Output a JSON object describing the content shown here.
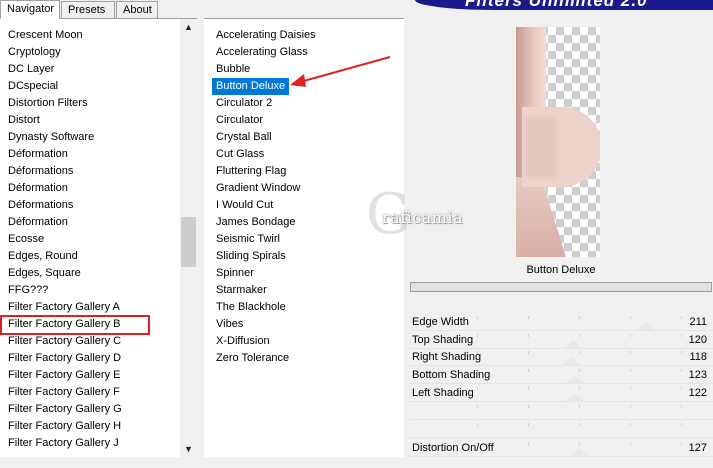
{
  "tabs": [
    "Navigator",
    "Presets",
    "About"
  ],
  "banner_title": "Filters Unlimited 2.0",
  "categories": [
    "Crescent Moon",
    "Cryptology",
    "DC Layer",
    "DCspecial",
    "Distortion Filters",
    "Distort",
    "Dynasty Software",
    "Déformation",
    "Déformations",
    "Déformation",
    "Déformations",
    "Déformation",
    "Ecosse",
    "Edges, Round",
    "Edges, Square",
    "FFG???",
    "Filter Factory Gallery A",
    "Filter Factory Gallery B",
    "Filter Factory Gallery C",
    "Filter Factory Gallery D",
    "Filter Factory Gallery E",
    "Filter Factory Gallery F",
    "Filter Factory Gallery G",
    "Filter Factory Gallery H",
    "Filter Factory Gallery J"
  ],
  "highlighted_category": "Filter Factory Gallery B",
  "filters": [
    "Accelerating Daisies",
    "Accelerating Glass",
    "Bubble",
    "Button Deluxe",
    "Circulator 2",
    "Circulator",
    "Crystal Ball",
    "Cut Glass",
    "Fluttering Flag",
    "Gradient Window",
    "I Would Cut",
    "James Bondage",
    "Seismic Twirl",
    "Sliding Spirals",
    "Spinner",
    "Starmaker",
    "The Blackhole",
    "Vibes",
    "X-Diffusion",
    "Zero Tolerance"
  ],
  "selected_filter": "Button Deluxe",
  "watermark": {
    "letter": "G",
    "text": "raficamia"
  },
  "params": {
    "filter_name": "Button Deluxe",
    "sliders": [
      {
        "label": "Edge Width",
        "value": "211",
        "level": 0.83
      },
      {
        "label": "Top Shading",
        "value": "120",
        "level": 0.47
      },
      {
        "label": "Right Shading",
        "value": "118",
        "level": 0.46
      },
      {
        "label": "Bottom Shading",
        "value": "123",
        "level": 0.48
      },
      {
        "label": "Left Shading",
        "value": "122",
        "level": 0.48
      },
      {
        "label": "",
        "value": "",
        "level": null
      },
      {
        "label": "",
        "value": "",
        "level": null
      },
      {
        "label": "Distortion On/Off",
        "value": "127",
        "level": 0.5
      }
    ]
  },
  "colors": {
    "selection": "#0078d7",
    "annotation_red": "#e02020",
    "banner": "#1a1a8a"
  }
}
